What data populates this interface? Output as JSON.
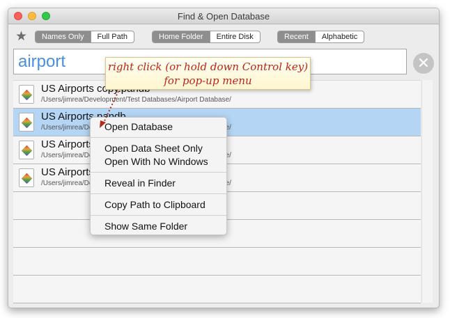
{
  "window": {
    "title": "Find & Open Database"
  },
  "toolbar": {
    "names_only": "Names Only",
    "full_path": "Full Path",
    "home_folder": "Home Folder",
    "entire_disk": "Entire Disk",
    "recent": "Recent",
    "alphabetic": "Alphabetic"
  },
  "search": {
    "value": "airport"
  },
  "results": [
    {
      "name": "US Airports copy.pandb",
      "path": "/Users/jimrea/Development/Test Databases/Airport Database/"
    },
    {
      "name": "US Airports.pandb",
      "path": "/Users/jimrea/Development/Test Databases/Airport Database/"
    },
    {
      "name": "US Airports",
      "path": "/Users/jimrea/Development/Test Databases/Airport Database/"
    },
    {
      "name": "US Airports",
      "path": "/Users/jimrea/Development/Test Databases/Airport Database/"
    }
  ],
  "context_menu": {
    "open_database": "Open Database",
    "open_data_sheet": "Open Data Sheet Only",
    "open_no_windows": "Open With No Windows",
    "reveal": "Reveal in Finder",
    "copy_path": "Copy Path to Clipboard",
    "same_folder": "Show Same Folder"
  },
  "callout": {
    "line1": "right click (or hold down Control key)",
    "line2": "for pop-up menu"
  }
}
